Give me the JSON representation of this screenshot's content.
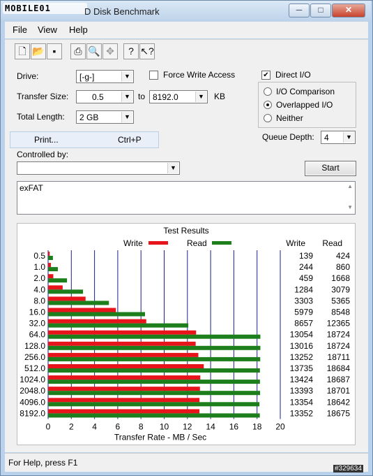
{
  "window": {
    "title": "D Disk Benchmark",
    "logo_text": "MOBILE01",
    "watermark": "#329634"
  },
  "caption_buttons": {
    "minimize": "─",
    "maximize": "□",
    "close": "✕"
  },
  "menu": [
    "File",
    "View",
    "Help"
  ],
  "toolbar": [
    "new-icon",
    "open-icon",
    "save-icon",
    "print-icon",
    "print-preview-icon",
    "move-icon",
    "help-icon",
    "context-help-icon"
  ],
  "form": {
    "drive_label": "Drive:",
    "drive_value": "[-g-]",
    "force_write_label": "Force Write Access",
    "direct_io_label": "Direct I/O",
    "transfer_size_label": "Transfer Size:",
    "transfer_from": "0.5",
    "to_label": "to",
    "transfer_to": "8192.0",
    "kb_label": "KB",
    "total_length_label": "Total Length:",
    "total_length_value": "2 GB",
    "io_comparison_label": "I/O Comparison",
    "overlapped_io_label": "Overlapped I/O",
    "neither_label": "Neither",
    "queue_depth_label": "Queue Depth:",
    "queue_depth_value": "4",
    "controlled_by_label": "Controlled by:",
    "controlled_by_value": "",
    "start_label": "Start",
    "description_text": "exFAT"
  },
  "popup": {
    "label": "Print...",
    "shortcut": "Ctrl+P"
  },
  "status": {
    "text": "For Help, press F1"
  },
  "chart_data": {
    "type": "bar",
    "orientation": "horizontal",
    "title": "Test Results",
    "xlabel": "Transfer Rate - MB / Sec",
    "xlim": [
      0,
      20
    ],
    "xticks": [
      "0",
      "2",
      "4",
      "6",
      "8",
      "10",
      "12",
      "14",
      "16",
      "18",
      "20"
    ],
    "grid": true,
    "legend": "top",
    "categories": [
      "0.5",
      "1.0",
      "2.0",
      "4.0",
      "8.0",
      "16.0",
      "32.0",
      "64.0",
      "128.0",
      "256.0",
      "512.0",
      "1024.0",
      "2048.0",
      "4096.0",
      "8192.0"
    ],
    "column_headers": [
      "Write",
      "Read"
    ],
    "series": [
      {
        "name": "Write",
        "color": "#e8141b",
        "values": [
          139,
          244,
          459,
          1284,
          3303,
          5979,
          8657,
          13054,
          13016,
          13252,
          13735,
          13424,
          13393,
          13354,
          13352
        ]
      },
      {
        "name": "Read",
        "color": "#1c7f1c",
        "values": [
          424,
          860,
          1668,
          3079,
          5365,
          8548,
          12365,
          18724,
          18724,
          18711,
          18684,
          18687,
          18701,
          18642,
          18675
        ]
      }
    ],
    "value_unit_divisor": 1024
  }
}
